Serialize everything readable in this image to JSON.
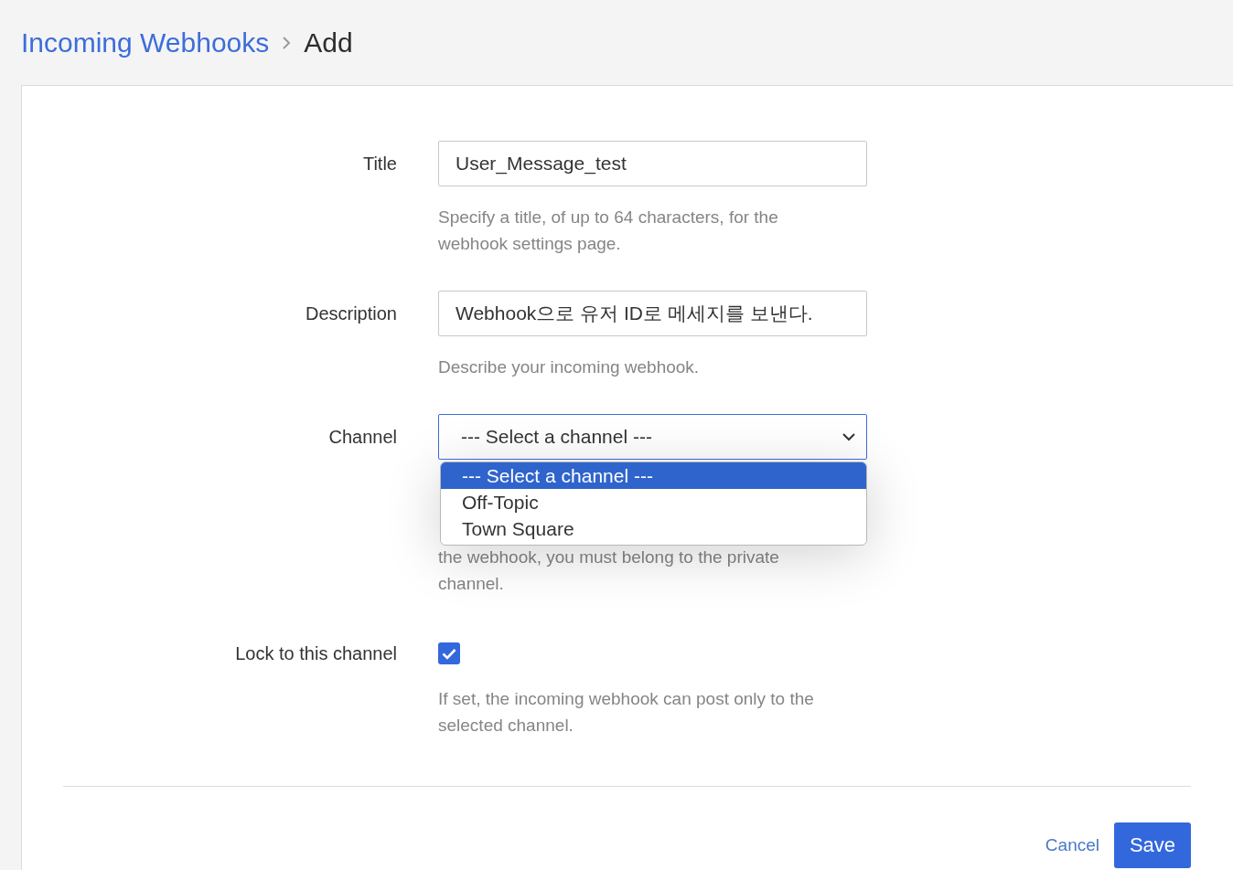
{
  "breadcrumb": {
    "parent": "Incoming Webhooks",
    "current": "Add"
  },
  "fields": [
    {
      "kind": "text",
      "label": "Title",
      "value": "User_Message_test",
      "help": "Specify a title, of up to 64 characters, for the webhook settings page."
    },
    {
      "kind": "text",
      "label": "Description",
      "value": "Webhook으로 유저 ID로 메세지를 보낸다.",
      "help": "Describe your incoming webhook."
    },
    {
      "kind": "select",
      "label": "Channel",
      "value": "--- Select a channel ---",
      "expanded": true,
      "options": [
        {
          "label": "--- Select a channel ---",
          "selected": true
        },
        {
          "label": "Off-Topic",
          "selected": false
        },
        {
          "label": "Town Square",
          "selected": false
        }
      ],
      "help": "the webhook, you must belong to the private channel."
    },
    {
      "kind": "checkbox",
      "label": "Lock to this channel",
      "checked": true,
      "help": "If set, the incoming webhook can post only to the selected channel."
    }
  ],
  "actions": [
    {
      "kind": "link",
      "label": "Cancel"
    },
    {
      "kind": "primary",
      "label": "Save"
    }
  ]
}
